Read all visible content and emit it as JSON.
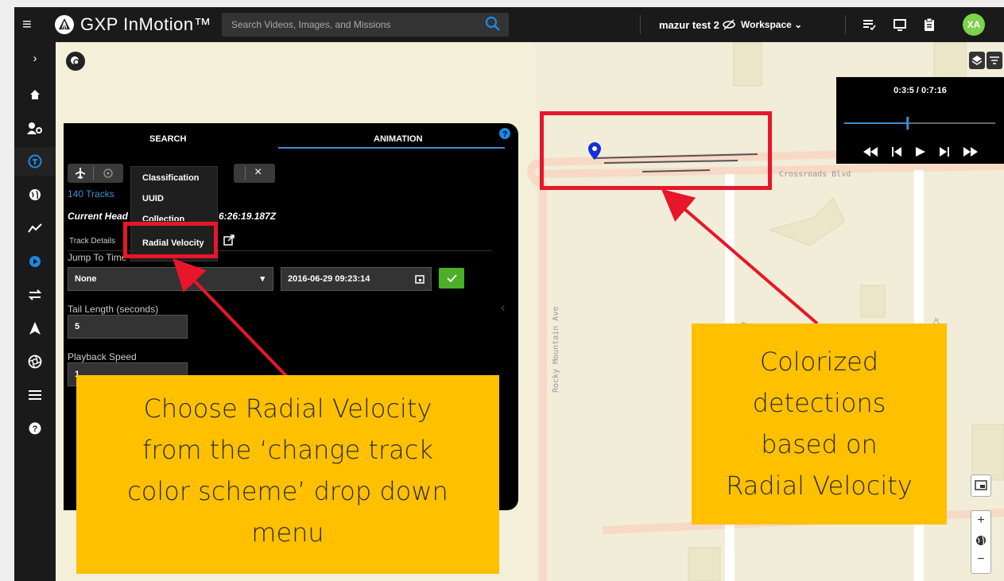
{
  "app": {
    "name": "GXP InMotion™",
    "search_placeholder": "Search Videos, Images, and Missions",
    "user": "mazur test 2",
    "workspace_label": "Workspace",
    "avatar_initials": "XA"
  },
  "panel": {
    "tabs": [
      "SEARCH",
      "ANIMATION"
    ],
    "track_count": "140 Tracks",
    "current_head_label": "Current Head",
    "current_head_value": "6:26:19.187Z",
    "track_details": "Track Details",
    "jump_to_time_label": "Jump To Time",
    "jump_select": "None",
    "jump_datetime": "2016-06-29 09:23:14",
    "tail_label": "Tail Length (seconds)",
    "tail_value": "5",
    "speed_label": "Playback Speed",
    "speed_value": "1"
  },
  "dropdown": {
    "items": [
      "Classification",
      "UUID",
      "Collection",
      "Radial Velocity"
    ]
  },
  "player": {
    "time": "0:3:5 / 0:7:16",
    "progress": 0.42
  },
  "map": {
    "labels": {
      "crossroads": "Crossroads Blvd",
      "rocky": "Rocky Mountain Ave",
      "dr1": "Dr",
      "dr2": "Dr"
    }
  },
  "callouts": {
    "left": [
      "Choose Radial Velocity",
      "from the ‘change track",
      "color scheme’ drop down",
      "menu"
    ],
    "right": [
      "Colorized",
      "detections",
      "based on",
      "Radial Velocity"
    ]
  },
  "colors": {
    "accent": "#1e88e5",
    "callout": "#ffc000",
    "highlight": "#e8162b",
    "avatar": "#7dd34a",
    "confirm": "#4caf27"
  }
}
